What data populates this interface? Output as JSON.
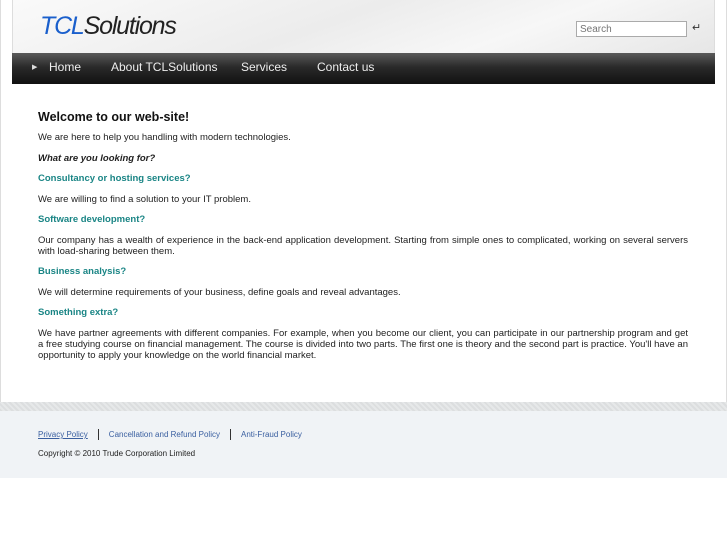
{
  "header": {
    "logo_prefix": "TCL",
    "logo_suffix": "Solutions",
    "search_placeholder": "Search",
    "enter_glyph": "↵"
  },
  "nav": {
    "items": [
      {
        "label": "Home"
      },
      {
        "label": "About TCLSolutions"
      },
      {
        "label": "Services"
      },
      {
        "label": "Contact us"
      }
    ]
  },
  "main": {
    "title": "Welcome to our web-site!",
    "intro": "We are here to help you handling with modern technologies.",
    "question": "What are you looking for?",
    "sections": [
      {
        "heading": "Consultancy or hosting services?",
        "text": "We are willing to find a solution to your IT problem."
      },
      {
        "heading": "Software development?",
        "text": "Our company has a wealth of experience in the back-end application development. Starting from simple ones to complicated, working on several servers with load-sharing between them."
      },
      {
        "heading": "Business analysis?",
        "text": "We will determine requirements of your business, define goals and reveal advantages."
      },
      {
        "heading": "Something extra?",
        "text": "We have partner agreements with different companies. For example, when you become our client, you can participate in our partnership program and get a free studying course on financial management. The course is divided into two parts. The first one is theory and the second part is practice. You'll have an opportunity to apply your knowledge on the world financial market."
      }
    ]
  },
  "footer": {
    "links": [
      {
        "label": "Privacy Policy"
      },
      {
        "label": "Cancellation and Refund Policy"
      },
      {
        "label": "Anti-Fraud Policy"
      }
    ],
    "copyright": "Copyright © 2010 Trude Corporation Limited"
  }
}
